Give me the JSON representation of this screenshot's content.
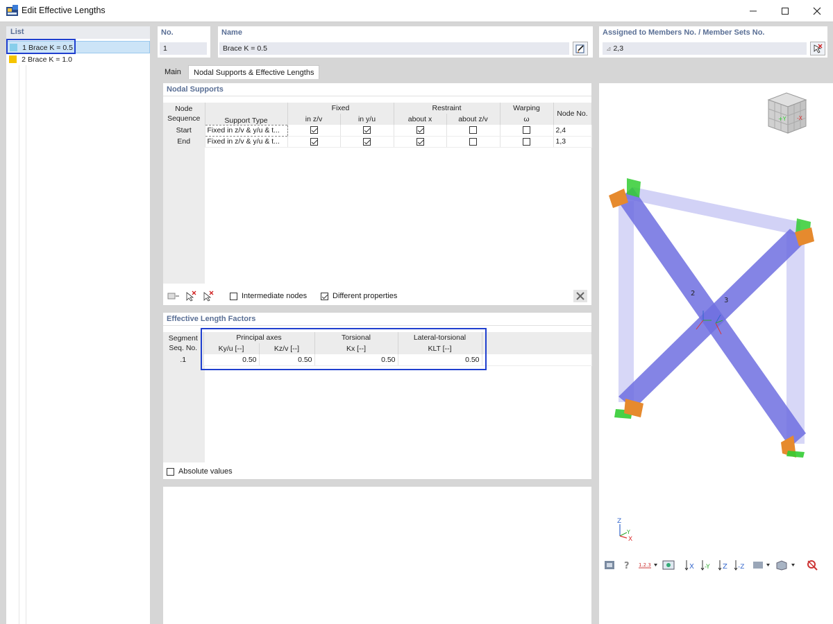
{
  "window": {
    "title": "Edit Effective Lengths"
  },
  "list": {
    "header": "List",
    "items": [
      {
        "no": "1",
        "label": "Brace K = 0.5",
        "color": "#87ceeb"
      },
      {
        "no": "2",
        "label": "Brace K = 1.0",
        "color": "#f5c400"
      }
    ]
  },
  "fields": {
    "no_label": "No.",
    "no_value": "1",
    "name_label": "Name",
    "name_value": "Brace K = 0.5",
    "assigned_label": "Assigned to Members No. / Member Sets No.",
    "assigned_value": "2,3"
  },
  "tabs": [
    "Main",
    "Nodal Supports & Effective Lengths"
  ],
  "nodal_supports": {
    "title": "Nodal Supports",
    "headers": {
      "node_sequence": "Node Sequence",
      "support_type": "Support Type",
      "fixed": "Fixed",
      "fixed_zv": "in z/v",
      "fixed_yu": "in y/u",
      "restraint": "Restraint",
      "about_x": "about x",
      "about_zv": "about z/v",
      "warping": "Warping",
      "omega": "ω",
      "node_no": "Node No."
    },
    "rows": [
      {
        "seq": "Start",
        "type": "Fixed in z/v & y/u & t...",
        "fixed_zv": true,
        "fixed_yu": true,
        "about_x": true,
        "about_zv": false,
        "warping": false,
        "node": "2,4"
      },
      {
        "seq": "End",
        "type": "Fixed in z/v & y/u & t...",
        "fixed_zv": true,
        "fixed_yu": true,
        "about_x": true,
        "about_zv": false,
        "warping": false,
        "node": "1,3"
      }
    ],
    "intermediate_nodes": {
      "label": "Intermediate nodes",
      "checked": false
    },
    "different_properties": {
      "label": "Different properties",
      "checked": true
    }
  },
  "effective_lengths": {
    "title": "Effective Length Factors",
    "headers": {
      "segment": "Segment Seq. No.",
      "principal_axes": "Principal axes",
      "ky": "Ky/u [--]",
      "kz": "Kz/v [--]",
      "torsional": "Torsional",
      "kx": "Kx [--]",
      "lateral_torsional": "Lateral-torsional",
      "klt": "KLT [--]"
    },
    "rows": [
      {
        "seq": ".1",
        "ky": "0.50",
        "kz": "0.50",
        "kx": "0.50",
        "klt": "0.50"
      }
    ],
    "absolute_values": {
      "label": "Absolute values",
      "checked": false
    }
  },
  "view": {
    "member_labels": [
      "2",
      "3"
    ],
    "member_color": "#6f6fe0",
    "axis_labels": {
      "x": "X",
      "y": "Y",
      "z": "Z"
    },
    "toolbar_icons": [
      "render-icon",
      "info-icon",
      "numbering-icon",
      "view-icon",
      "view-x-icon",
      "view-neg-y-icon",
      "view-z-icon",
      "view-neg-z-icon",
      "display-icon",
      "iso-icon",
      "reset-icon"
    ]
  },
  "colors": {
    "accent": "#5a6f95",
    "highlight": "#1f3fcf",
    "selection": "#cce4f7"
  }
}
